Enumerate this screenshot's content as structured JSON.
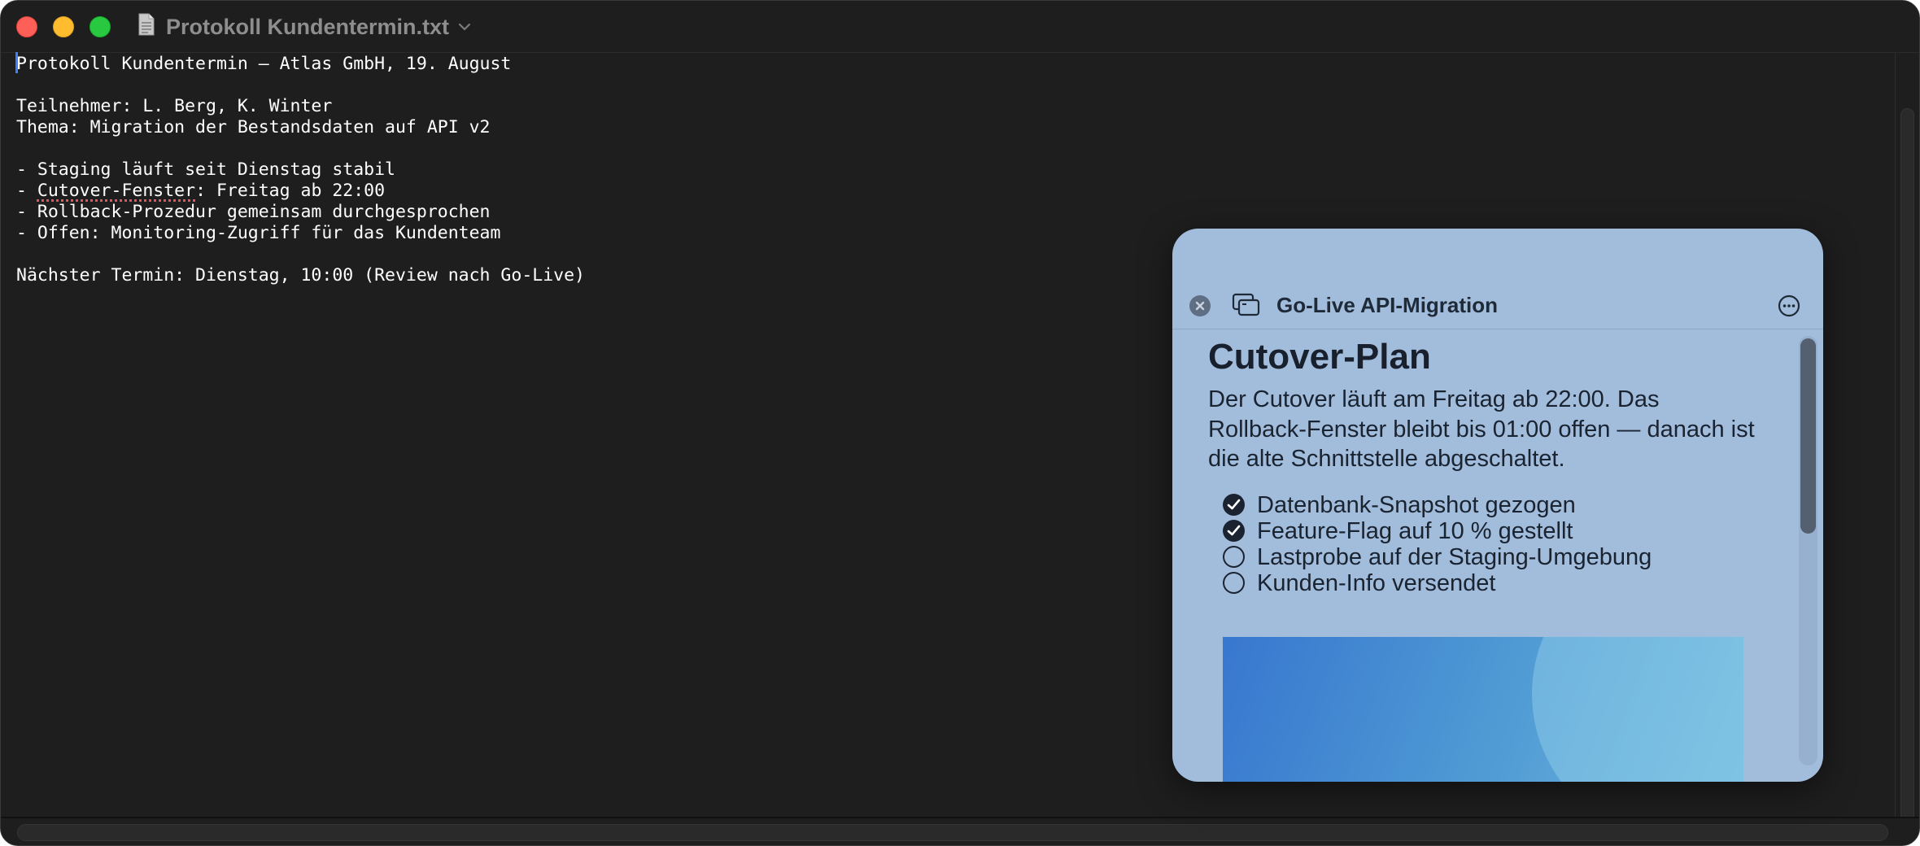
{
  "window": {
    "title": "Protokoll Kundentermin.txt",
    "document_icon": "text-document-icon",
    "title_menu_icon": "chevron-down-icon"
  },
  "editor": {
    "lines": [
      "Protokoll Kundentermin – Atlas GmbH, 19. August",
      "",
      "Teilnehmer: L. Berg, K. Winter",
      "Thema: Migration der Bestandsdaten auf API v2",
      "",
      "- Staging läuft seit Dienstag stabil",
      "- Cutover-Fenster: Freitag ab 22:00",
      "- Rollback-Prozedur gemeinsam durchgesprochen",
      "- Offen: Monitoring-Zugriff für das Kundenteam",
      "",
      "Nächster Termin: Dienstag, 10:00 (Review nach Go-Live)"
    ],
    "misspelled_word": "Cutover-Fenster"
  },
  "panel": {
    "title": "Go-Live API-Migration",
    "close_icon": "close-icon",
    "stack_icon": "stacked-windows-icon",
    "more_icon": "more-options-icon",
    "heading": "Cutover-Plan",
    "paragraph": "Der Cutover läuft am Freitag ab 22:00. Das Rollback-Fenster bleibt bis 01:00 offen — danach ist die alte Schnittstelle abgeschaltet.",
    "checklist": [
      {
        "label": "Datenbank-Snapshot gezogen",
        "checked": true
      },
      {
        "label": "Feature-Flag auf 10 % gestellt",
        "checked": true
      },
      {
        "label": "Lastprobe auf der Staging-Umgebung",
        "checked": false
      },
      {
        "label": "Kunden-Info versendet",
        "checked": false
      }
    ]
  },
  "colors": {
    "editor_background": "#1e1e1e",
    "panel_background": "#a2bcdc",
    "caret": "#3b82f6",
    "spellcheck_underline": "#e0575b"
  }
}
